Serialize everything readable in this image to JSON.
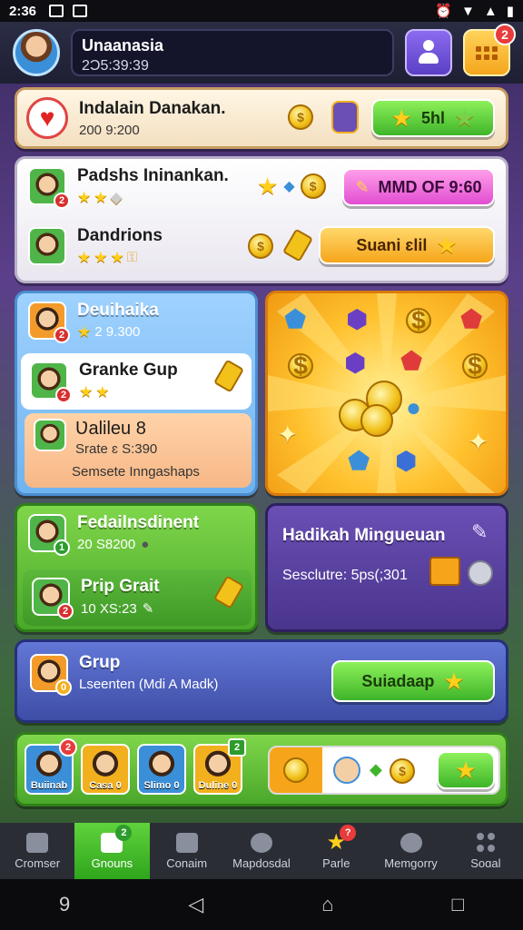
{
  "status_bar": {
    "time": "2:36"
  },
  "header": {
    "user_name": "Unaanasia",
    "user_sub": "2Ɔ5:39:39",
    "notification_count": "2"
  },
  "card1": {
    "title": "Indalain Danakan.",
    "sub": "200 9:200",
    "button_label": "5hl"
  },
  "card2": {
    "row1": {
      "title": "Padshs Ininankan.",
      "button_label": "MMD OF 9:60",
      "badge": "2"
    },
    "row2": {
      "title": "Dandrions",
      "button_label": "Suani ɛlil"
    }
  },
  "card3": {
    "row1": {
      "title": "Deuihaika",
      "sub": "2 9.300",
      "badge": "2"
    },
    "row2": {
      "title": "Granke Gup",
      "badge": "2"
    },
    "row3": {
      "title": "Ʋalileu 8",
      "sub1": "Srate ɛ S:390",
      "sub2": "Semsete Inngashaps"
    }
  },
  "card5": {
    "row1": {
      "title": "Fedailnsdinent",
      "sub": "20 S8200",
      "badge": "1"
    },
    "row2": {
      "title": "Prip Grait",
      "sub": "10 XS:23",
      "badge": "2"
    }
  },
  "card6": {
    "title": "Hadikah Mingueuan",
    "sub": "Sesclutre: 5ps(;301"
  },
  "card7": {
    "title": "Grup",
    "sub": "Lseenten (Mdi A Madk)",
    "button_label": "Suiadaap"
  },
  "card8": {
    "characters": [
      {
        "label": "Buiinab",
        "tag": "2"
      },
      {
        "label": "Casa 0",
        "tag": ""
      },
      {
        "label": "Slimo 0",
        "tag": ""
      },
      {
        "label": "Duline 0",
        "tag": "2"
      }
    ]
  },
  "bottom_nav": [
    {
      "label": "Cromser"
    },
    {
      "label": "Gnouns",
      "badge": "2"
    },
    {
      "label": "Conaim"
    },
    {
      "label": "Mapdosdal"
    },
    {
      "label": "Parle",
      "badge": "?"
    },
    {
      "label": "Memgorry"
    },
    {
      "label": "Soɑal"
    }
  ],
  "colors": {
    "green_button": "#3fb52a",
    "orange_button": "#f6a51a",
    "pink_button": "#e24ed2",
    "badge_red": "#e83b3b"
  }
}
